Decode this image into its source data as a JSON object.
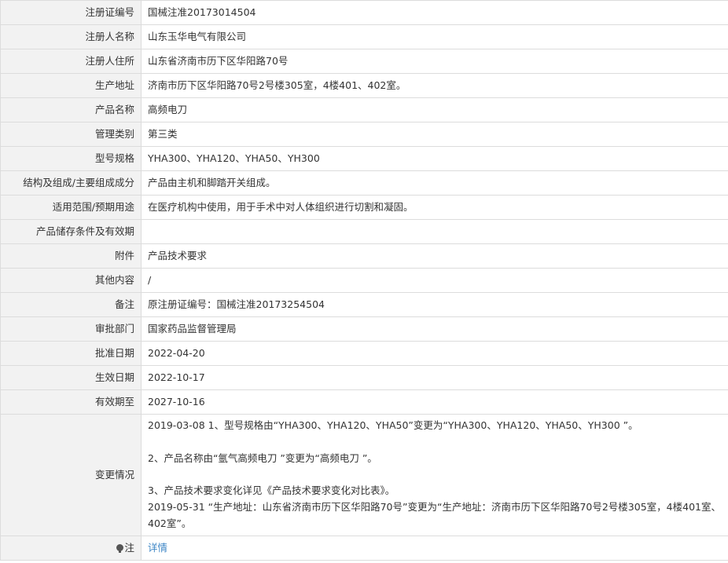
{
  "rows": [
    {
      "label": "注册证编号",
      "value": "国械注准20173014504"
    },
    {
      "label": "注册人名称",
      "value": "山东玉华电气有限公司"
    },
    {
      "label": "注册人住所",
      "value": "山东省济南市历下区华阳路70号"
    },
    {
      "label": "生产地址",
      "value": "济南市历下区华阳路70号2号楼305室，4楼401、402室。"
    },
    {
      "label": "产品名称",
      "value": "高频电刀"
    },
    {
      "label": "管理类别",
      "value": "第三类"
    },
    {
      "label": "型号规格",
      "value": "YHA300、YHA120、YHA50、YH300"
    },
    {
      "label": "结构及组成/主要组成成分",
      "value": "产品由主机和脚踏开关组成。"
    },
    {
      "label": "适用范围/预期用途",
      "value": "在医疗机构中使用，用于手术中对人体组织进行切割和凝固。"
    },
    {
      "label": "产品储存条件及有效期",
      "value": ""
    },
    {
      "label": "附件",
      "value": "产品技术要求"
    },
    {
      "label": "其他内容",
      "value": "/"
    },
    {
      "label": "备注",
      "value": "原注册证编号：国械注准20173254504"
    },
    {
      "label": "审批部门",
      "value": "国家药品监督管理局"
    },
    {
      "label": "批准日期",
      "value": "2022-04-20"
    },
    {
      "label": "生效日期",
      "value": "2022-10-17"
    },
    {
      "label": "有效期至",
      "value": "2027-10-16"
    }
  ],
  "changes": {
    "label": "变更情况",
    "lines": [
      "2019-03-08 1、型号规格由“YHA300、YHA120、YHA50”变更为“YHA300、YHA120、YHA50、YH300 ”。",
      "2、产品名称由“氩气高频电刀 ”变更为“高频电刀 ”。",
      "3、产品技术要求变化详见《产品技术要求变化对比表》。",
      "2019-05-31 “生产地址：山东省济南市历下区华阳路70号”变更为“生产地址：济南市历下区华阳路70号2号楼305室，4楼401室、402室”。"
    ]
  },
  "note": {
    "label": "注",
    "icon": "lightbulb-icon",
    "link_text": "详情",
    "link_color": "#3d86c6"
  },
  "colors": {
    "label_bg": "#f2f2f2",
    "border": "#dcdcdc",
    "text": "#333333"
  }
}
